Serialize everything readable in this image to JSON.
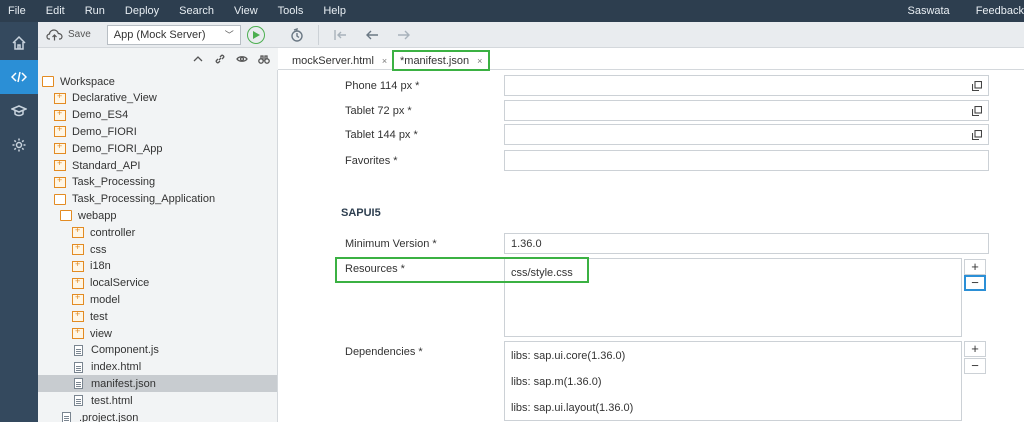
{
  "menubar": {
    "items": [
      "File",
      "Edit",
      "Run",
      "Deploy",
      "Search",
      "View",
      "Tools",
      "Help"
    ],
    "user": "Saswata",
    "feedback": "Feedback"
  },
  "toolbar": {
    "save_label": "Save",
    "run_config": "App (Mock Server)"
  },
  "tree": {
    "items": [
      {
        "label": "Workspace",
        "type": "folder-open",
        "level": 0
      },
      {
        "label": "Declarative_View",
        "type": "folder",
        "level": 1
      },
      {
        "label": "Demo_ES4",
        "type": "folder",
        "level": 1
      },
      {
        "label": "Demo_FIORI",
        "type": "folder",
        "level": 1
      },
      {
        "label": "Demo_FIORI_App",
        "type": "folder",
        "level": 1
      },
      {
        "label": "Standard_API",
        "type": "folder",
        "level": 1
      },
      {
        "label": "Task_Processing",
        "type": "folder",
        "level": 1
      },
      {
        "label": "Task_Processing_Application",
        "type": "folder-open",
        "level": 1
      },
      {
        "label": "webapp",
        "type": "folder-open",
        "level": 2
      },
      {
        "label": "controller",
        "type": "folder",
        "level": 3
      },
      {
        "label": "css",
        "type": "folder",
        "level": 3
      },
      {
        "label": "i18n",
        "type": "folder",
        "level": 3
      },
      {
        "label": "localService",
        "type": "folder",
        "level": 3
      },
      {
        "label": "model",
        "type": "folder",
        "level": 3
      },
      {
        "label": "test",
        "type": "folder",
        "level": 3
      },
      {
        "label": "view",
        "type": "folder",
        "level": 3
      },
      {
        "label": "Component.js",
        "type": "file",
        "level": 3
      },
      {
        "label": "index.html",
        "type": "file",
        "level": 3
      },
      {
        "label": "manifest.json",
        "type": "file",
        "level": 3,
        "selected": true
      },
      {
        "label": "test.html",
        "type": "file",
        "level": 3
      },
      {
        "label": ".project.json",
        "type": "file",
        "level": 2
      }
    ]
  },
  "tabs": [
    {
      "label": "mockServer.html",
      "close": "×"
    },
    {
      "label": "*manifest.json",
      "close": "×"
    }
  ],
  "form": {
    "phone114_label": "Phone 114 px *",
    "tablet72_label": "Tablet 72 px *",
    "tablet144_label": "Tablet 144 px *",
    "favorites_label": "Favorites *",
    "section_title": "SAPUI5",
    "min_version_label": "Minimum Version *",
    "min_version_value": "1.36.0",
    "resources_label": "Resources *",
    "resources": [
      "css/style.css"
    ],
    "dependencies_label": "Dependencies *",
    "dependencies": [
      "libs: sap.ui.core(1.36.0)",
      "libs: sap.m(1.36.0)",
      "libs: sap.ui.layout(1.36.0)"
    ],
    "plus": "+",
    "minus": "−"
  },
  "colors": {
    "menubar_bg": "#2d3e4f",
    "rail_bg": "#34495e",
    "rail_active": "#2b8fd6",
    "highlight_green": "#3bb143",
    "folder_orange": "#e38b22"
  }
}
